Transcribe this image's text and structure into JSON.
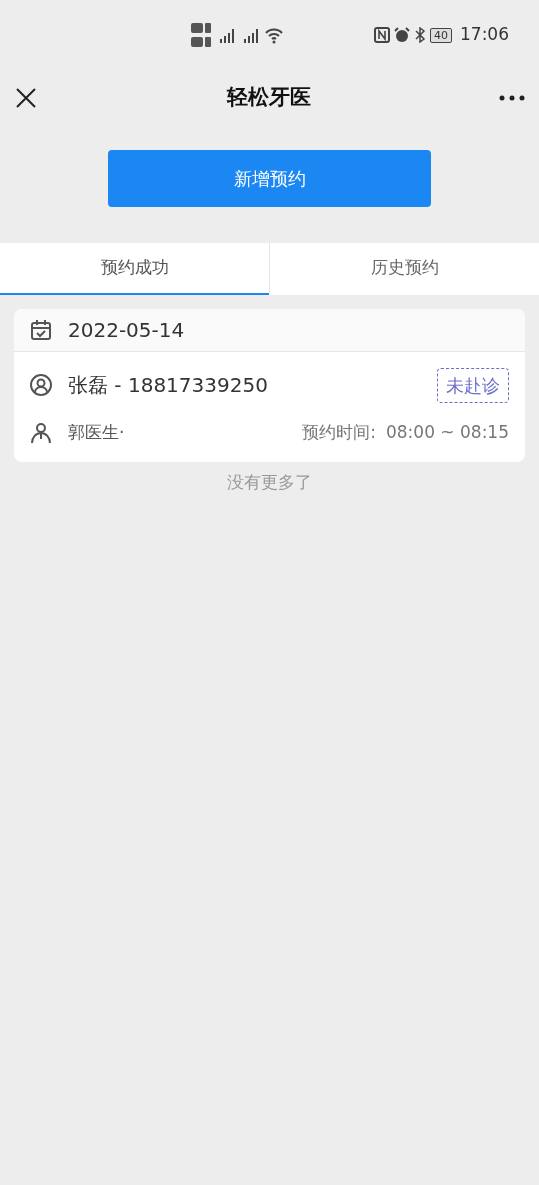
{
  "status_bar": {
    "battery": "40",
    "time": "17:06"
  },
  "header": {
    "title": "轻松牙医"
  },
  "action_button": {
    "label": "新增预约"
  },
  "tabs": [
    {
      "label": "预约成功",
      "selected": true
    },
    {
      "label": "历史预约",
      "selected": false
    }
  ],
  "appointments": [
    {
      "date": "2022-05-14",
      "patient": "张磊 - 18817339250",
      "status": "未赴诊",
      "doctor": "郭医生·",
      "time_label": "预约时间:",
      "time": "08:00 ~ 08:15"
    }
  ],
  "footer": "没有更多了"
}
